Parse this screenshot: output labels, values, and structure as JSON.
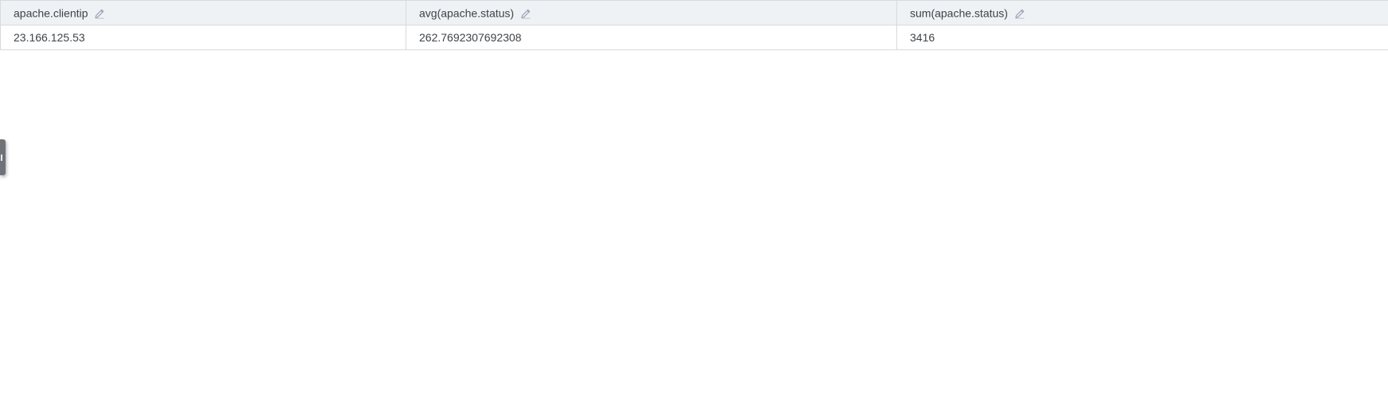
{
  "table": {
    "columns": [
      {
        "label": "apache.clientip",
        "icon": "pencil-icon"
      },
      {
        "label": "avg(apache.status)",
        "icon": "pencil-icon"
      },
      {
        "label": "sum(apache.status)",
        "icon": "pencil-icon"
      }
    ],
    "rows": [
      [
        "23.166.125.53",
        "262.7692307692308",
        "3416"
      ]
    ]
  },
  "colors": {
    "header_bg": "#eff2f5",
    "border": "#d6dade",
    "text": "#3f4348",
    "icon": "#9aa4b8",
    "handle": "#6f7378"
  }
}
